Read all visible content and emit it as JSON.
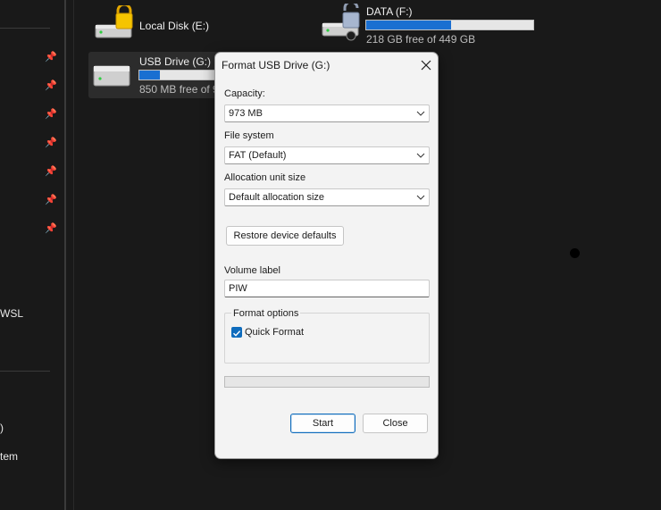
{
  "nav": {
    "items": [
      "WSL",
      ")",
      "tem"
    ]
  },
  "drives": {
    "e": {
      "name": "Local Disk (E:)"
    },
    "f": {
      "name": "DATA (F:)",
      "free": "218 GB free of 449 GB",
      "used_fraction": 0.51
    },
    "g": {
      "name": "USB Drive (G:)",
      "free": "850 MB free of 9",
      "used_fraction": 0.25
    }
  },
  "dialog": {
    "title": "Format USB Drive (G:)",
    "capacity_label": "Capacity:",
    "capacity_value": "973 MB",
    "filesystem_label": "File system",
    "filesystem_value": "FAT (Default)",
    "alloc_label": "Allocation unit size",
    "alloc_value": "Default allocation size",
    "restore_label": "Restore device defaults",
    "volume_label_label": "Volume label",
    "volume_label_value": "PIW",
    "format_options_label": "Format options",
    "quick_format_label": "Quick Format",
    "quick_format_checked": true,
    "progress": 0,
    "start_label": "Start",
    "close_label": "Close"
  },
  "colors": {
    "accent": "#0f6cbd",
    "drive_bar": "#1a6fd1",
    "background": "#191919",
    "dialog_bg": "#f3f3f3"
  }
}
